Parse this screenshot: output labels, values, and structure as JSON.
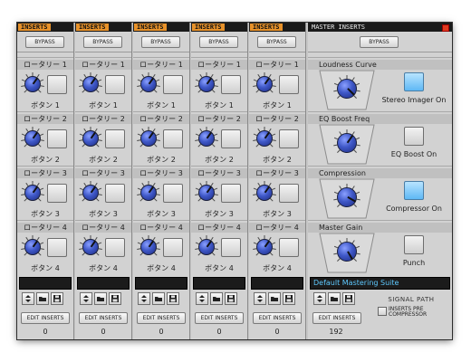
{
  "strips": [
    {
      "header": "INSERTS",
      "bypass": "BYPASS",
      "edit": "EDIT INSERTS",
      "count": "0",
      "slots": [
        {
          "rotary": "ロータリー 1",
          "button": "ボタン 1"
        },
        {
          "rotary": "ロータリー 2",
          "button": "ボタン 2"
        },
        {
          "rotary": "ロータリー 3",
          "button": "ボタン 3"
        },
        {
          "rotary": "ロータリー 4",
          "button": "ボタン 4"
        }
      ]
    },
    {
      "header": "INSERTS",
      "bypass": "BYPASS",
      "edit": "EDIT INSERTS",
      "count": "0",
      "slots": [
        {
          "rotary": "ロータリー 1",
          "button": "ボタン 1"
        },
        {
          "rotary": "ロータリー 2",
          "button": "ボタン 2"
        },
        {
          "rotary": "ロータリー 3",
          "button": "ボタン 3"
        },
        {
          "rotary": "ロータリー 4",
          "button": "ボタン 4"
        }
      ]
    },
    {
      "header": "INSERTS",
      "bypass": "BYPASS",
      "edit": "EDIT INSERTS",
      "count": "0",
      "slots": [
        {
          "rotary": "ロータリー 1",
          "button": "ボタン 1"
        },
        {
          "rotary": "ロータリー 2",
          "button": "ボタン 2"
        },
        {
          "rotary": "ロータリー 3",
          "button": "ボタン 3"
        },
        {
          "rotary": "ロータリー 4",
          "button": "ボタン 4"
        }
      ]
    },
    {
      "header": "INSERTS",
      "bypass": "BYPASS",
      "edit": "EDIT INSERTS",
      "count": "0",
      "slots": [
        {
          "rotary": "ロータリー 1",
          "button": "ボタン 1"
        },
        {
          "rotary": "ロータリー 2",
          "button": "ボタン 2"
        },
        {
          "rotary": "ロータリー 3",
          "button": "ボタン 3"
        },
        {
          "rotary": "ロータリー 4",
          "button": "ボタン 4"
        }
      ]
    },
    {
      "header": "INSERTS",
      "bypass": "BYPASS",
      "edit": "EDIT INSERTS",
      "count": "0",
      "slots": [
        {
          "rotary": "ロータリー 1",
          "button": "ボタン 1"
        },
        {
          "rotary": "ロータリー 2",
          "button": "ボタン 2"
        },
        {
          "rotary": "ロータリー 3",
          "button": "ボタン 3"
        },
        {
          "rotary": "ロータリー 4",
          "button": "ボタン 4"
        }
      ]
    }
  ],
  "master": {
    "header": "MASTER INSERTS",
    "bypass": "BYPASS",
    "sections": [
      {
        "label": "Loudness Curve",
        "button": "Stereo Imager On",
        "button_on": true
      },
      {
        "label": "EQ Boost Freq",
        "button": "EQ Boost On",
        "button_on": false
      },
      {
        "label": "Compression",
        "button": "Compressor On",
        "button_on": true
      },
      {
        "label": "Master Gain",
        "button": "Punch",
        "button_on": false
      }
    ],
    "preset": "Default Mastering Suite",
    "edit": "EDIT INSERTS",
    "count": "192",
    "signal_path": {
      "title": "SIGNAL PATH",
      "option": "INSERTS PRE COMPRESSOR",
      "checked": false
    }
  },
  "colors": {
    "insert_tag": "#e8922a",
    "knob": "#3f58c8",
    "button_on": "#5fb8f5",
    "preset_text": "#5ec9ff"
  },
  "icons": {
    "updown": "updown-arrows-icon",
    "folder": "folder-icon",
    "save": "save-disk-icon",
    "close": "close-icon"
  }
}
